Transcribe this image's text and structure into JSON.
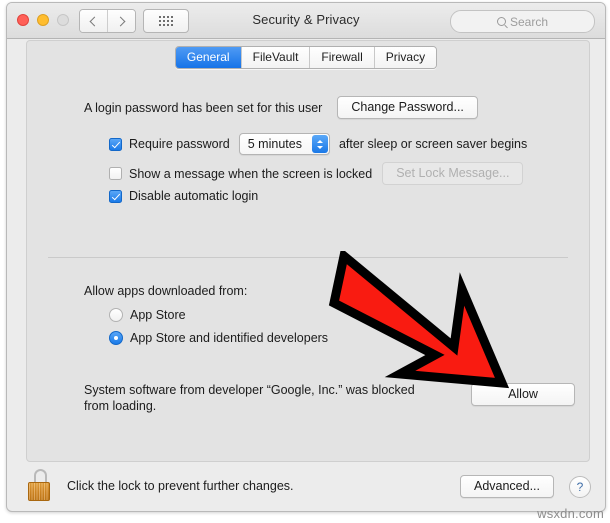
{
  "window": {
    "title": "Security & Privacy",
    "traffic_lights": [
      "close",
      "minimize",
      "zoom"
    ]
  },
  "toolbar": {
    "back_icon": "chevron-left-icon",
    "forward_icon": "chevron-right-icon",
    "show_all_icon": "grid-icon",
    "search": {
      "placeholder": "Search",
      "icon": "search-icon"
    }
  },
  "tabs": [
    {
      "label": "General",
      "active": true
    },
    {
      "label": "FileVault",
      "active": false
    },
    {
      "label": "Firewall",
      "active": false
    },
    {
      "label": "Privacy",
      "active": false
    }
  ],
  "general": {
    "login_password_text": "A login password has been set for this user",
    "change_password_button": "Change Password...",
    "require_password": {
      "label": "Require password",
      "checked": true,
      "delay_value": "5 minutes",
      "suffix": "after sleep or screen saver begins"
    },
    "show_message": {
      "label": "Show a message when the screen is locked",
      "checked": false,
      "button": "Set Lock Message...",
      "button_disabled": true
    },
    "disable_auto_login": {
      "label": "Disable automatic login",
      "checked": true
    },
    "allow_apps": {
      "heading": "Allow apps downloaded from:",
      "options": [
        {
          "label": "App Store",
          "selected": false
        },
        {
          "label": "App Store and identified developers",
          "selected": true
        }
      ]
    },
    "blocked_notice": {
      "text": "System software from developer “Google, Inc.” was blocked from loading.",
      "allow_button": "Allow"
    }
  },
  "bottom_bar": {
    "lock_icon": "padlock-open-icon",
    "lock_caption": "Click the lock to prevent further changes.",
    "advanced_button": "Advanced...",
    "help_button": "?"
  },
  "annotation": {
    "arrow_icon": "red-arrow-down-right-icon",
    "fill_color": "#f91b11",
    "stroke_color": "#000000"
  },
  "watermark": "wsxdn.com",
  "colors": {
    "accent_blue": "#1a7ae8",
    "window_bg": "#ececec",
    "panel_bg": "#e3e3e3",
    "lock_gold": "#d98c25"
  }
}
